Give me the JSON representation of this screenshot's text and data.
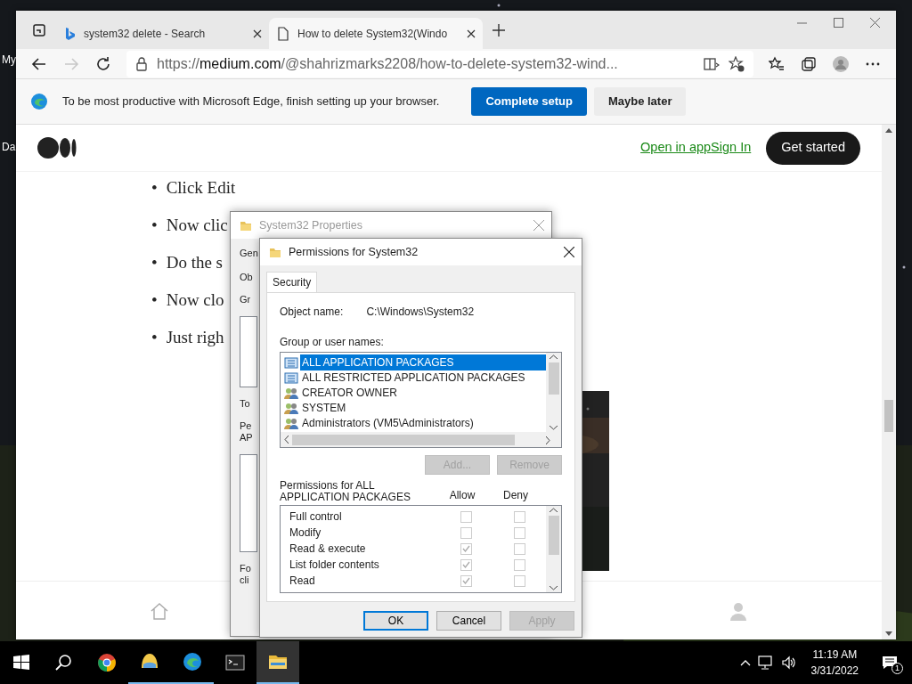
{
  "desktop_labels": [
    "My",
    "Da"
  ],
  "browser": {
    "tabs": [
      {
        "title": "system32 delete - Search",
        "selected": false,
        "kind": "search"
      },
      {
        "title": "How to delete System32(Windo",
        "selected": true,
        "kind": "page"
      }
    ],
    "address": "https://**medium.com**/@shahrizmarks2208/how-to-delete-system32-wind...",
    "forward_disabled": true,
    "infobar": {
      "message": "To be most productive with Microsoft Edge, finish setting up your browser.",
      "buttons": [
        {
          "label": "Complete setup",
          "kind": "primary"
        },
        {
          "label": "Maybe later",
          "kind": "secondary"
        }
      ]
    }
  },
  "page": {
    "header_links": [
      "Open in app",
      "Sign In"
    ],
    "cta": "Get started",
    "bullets": [
      {
        "marker": "•",
        "text": "Click Edit"
      },
      {
        "marker": "•",
        "text": "Now clic"
      },
      {
        "marker": "•",
        "text": "Do the s"
      },
      {
        "marker": "•",
        "text": "Now clo"
      },
      {
        "marker": "•",
        "text": "Just righ"
      }
    ]
  },
  "properties_dialog": {
    "title": "System32 Properties",
    "active": false,
    "tab": "Gen",
    "fragments": [
      {
        "text": "Ob",
        "kind": "text"
      },
      {
        "text": "Gr",
        "kind": "text"
      },
      {
        "kind": "listbox"
      },
      {
        "text": "To",
        "kind": "text"
      },
      {
        "text": "Pe\nAP",
        "kind": "text"
      },
      {
        "kind": "box"
      },
      {
        "text": "Fo\ncli",
        "kind": "text"
      }
    ]
  },
  "permissions_dialog": {
    "title": "Permissions for System32",
    "active": true,
    "tabs": [
      {
        "label": "Security",
        "selected": true
      }
    ],
    "object_label": "Object name:",
    "object_value": "C:\\Windows\\System32",
    "groups_label": "Group or user names:",
    "groups": [
      {
        "name": "ALL APPLICATION PACKAGES",
        "kind": "package",
        "selected": true
      },
      {
        "name": "ALL RESTRICTED APPLICATION PACKAGES",
        "kind": "package",
        "selected": false
      },
      {
        "name": "CREATOR OWNER",
        "kind": "users",
        "selected": false
      },
      {
        "name": "SYSTEM",
        "kind": "users",
        "selected": false
      },
      {
        "name": "Administrators (VM5\\Administrators)",
        "kind": "users",
        "selected": false
      }
    ],
    "group_buttons": [
      {
        "label": "Add...",
        "disabled": true
      },
      {
        "label": "Remove",
        "disabled": true
      }
    ],
    "permissions_label": [
      "Permissions for ALL",
      "APPLICATION PACKAGES"
    ],
    "columns": [
      "Allow",
      "Deny"
    ],
    "checkboxes_disabled": true,
    "permissions": [
      {
        "name": "Full control",
        "allow": false,
        "deny": false
      },
      {
        "name": "Modify",
        "allow": false,
        "deny": false
      },
      {
        "name": "Read & execute",
        "allow": true,
        "deny": false
      },
      {
        "name": "List folder contents",
        "allow": true,
        "deny": false
      },
      {
        "name": "Read",
        "allow": true,
        "deny": false
      }
    ],
    "buttons": [
      {
        "label": "OK",
        "default": true,
        "disabled": false
      },
      {
        "label": "Cancel",
        "default": false,
        "disabled": false
      },
      {
        "label": "Apply",
        "default": false,
        "disabled": true
      }
    ]
  },
  "taskbar": {
    "apps": [
      {
        "kind": "chrome",
        "running": false,
        "active": false
      },
      {
        "kind": "shell",
        "running": true,
        "active": false
      },
      {
        "kind": "edge",
        "running": true,
        "active": false
      },
      {
        "kind": "terminal",
        "running": false,
        "active": false
      },
      {
        "kind": "folder",
        "running": true,
        "active": true
      }
    ],
    "time": "11:19 AM",
    "date": "3/31/2022",
    "notifications": "1"
  }
}
